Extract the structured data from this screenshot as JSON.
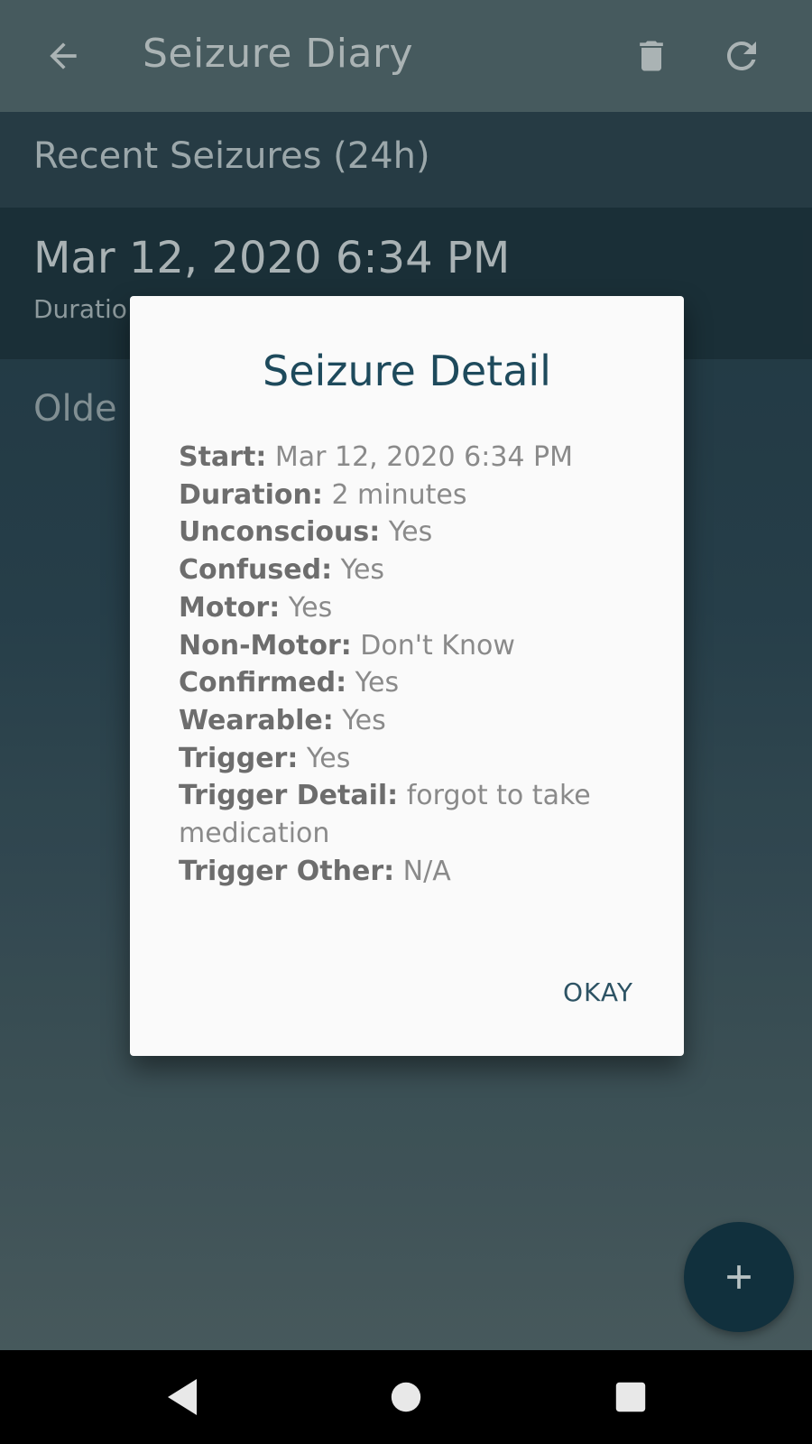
{
  "toolbar": {
    "title": "Seizure Diary",
    "back_icon": "arrow-left-icon",
    "delete_icon": "trash-icon",
    "refresh_icon": "refresh-icon"
  },
  "recent": {
    "header": "Recent Seizures (24h)",
    "entry": {
      "date": "Mar 12, 2020 6:34 PM",
      "sub_visible": "Duratio"
    }
  },
  "older": {
    "header_visible": "Olde"
  },
  "dialog": {
    "title": "Seizure Detail",
    "details": [
      {
        "label": "Start:",
        "value": "Mar 12, 2020 6:34 PM"
      },
      {
        "label": "Duration:",
        "value": "2 minutes"
      },
      {
        "label": "Unconscious:",
        "value": "Yes"
      },
      {
        "label": "Confused:",
        "value": "Yes"
      },
      {
        "label": "Motor:",
        "value": "Yes"
      },
      {
        "label": "Non-Motor:",
        "value": "Don't Know"
      },
      {
        "label": "Confirmed:",
        "value": "Yes"
      },
      {
        "label": "Wearable:",
        "value": "Yes"
      },
      {
        "label": "Trigger:",
        "value": "Yes"
      },
      {
        "label": "Trigger Detail:",
        "value": "forgot to take medication"
      },
      {
        "label": "Trigger Other:",
        "value": "N/A"
      }
    ],
    "okay_label": "OKAY"
  },
  "fab": {
    "icon": "plus-icon"
  },
  "navbar": {
    "back_icon": "nav-back-icon",
    "home_icon": "nav-home-icon",
    "recents_icon": "nav-recents-icon"
  },
  "colors": {
    "toolbar_bg": "#4d6266",
    "dialog_bg": "#fafafa",
    "accent": "#1e4a5c",
    "fab_bg": "#11303d"
  }
}
